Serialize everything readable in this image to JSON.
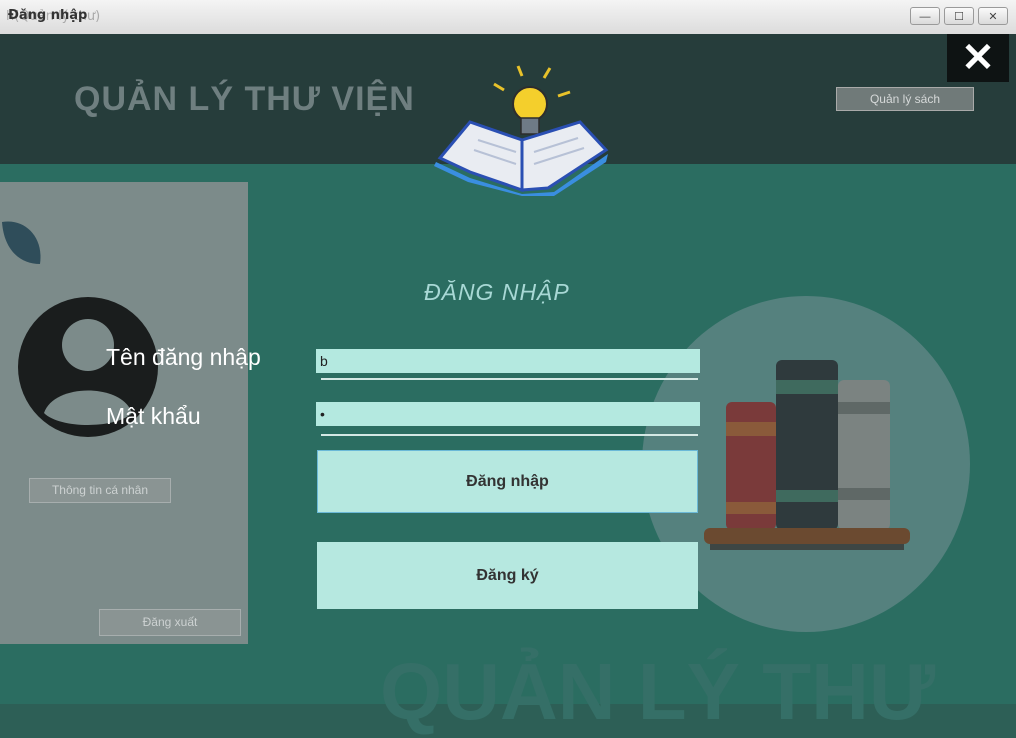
{
  "window": {
    "title": "Đăng nhập",
    "title_ghost": "h(Quản lý thư)",
    "controls": {
      "minimize": "—",
      "maximize": "☐",
      "close": "✕"
    }
  },
  "banner": {
    "app_title": "QUẢN LÝ THƯ VIỆN",
    "close_glyph": "✕",
    "manage_books_btn": "Quản lý sách"
  },
  "sidebar": {
    "profile_btn": "Thông tin cá nhân",
    "logout_btn": "Đăng xuất"
  },
  "form": {
    "heading": "ĐĂNG NHẬP",
    "username_label": "Tên đăng nhập",
    "username_value": "b",
    "password_label": "Mật khẩu",
    "password_value": "•",
    "login_btn": "Đăng nhập",
    "register_btn": "Đăng ký"
  },
  "watermark": "QUẢN LÝ THƯ",
  "colors": {
    "accent": "#b4e9e0",
    "banner": "#263d3b",
    "background": "#2b6d61"
  }
}
